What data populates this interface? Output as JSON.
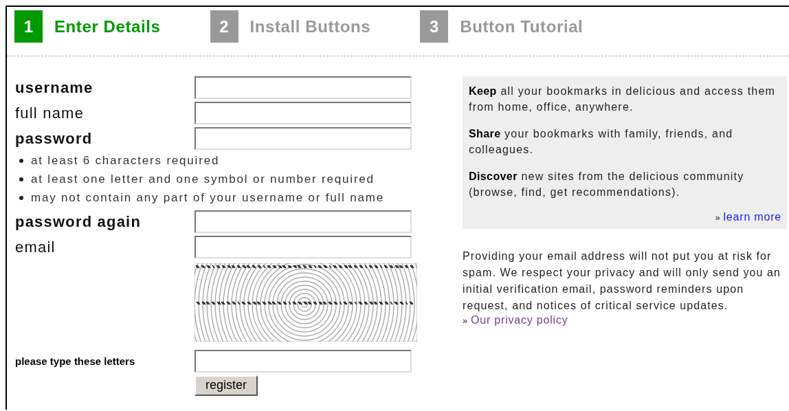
{
  "steps": [
    {
      "number": "1",
      "label": "Enter Details",
      "selected": true
    },
    {
      "number": "2",
      "label": "Install Buttons",
      "selected": false
    },
    {
      "number": "3",
      "label": "Button Tutorial",
      "selected": false
    }
  ],
  "form": {
    "fields": [
      {
        "label": "username",
        "required": true
      },
      {
        "label": "full name",
        "required": false
      },
      {
        "label": "password",
        "required": true,
        "rules": [
          "at least 6 characters required",
          "at least one letter and one symbol or number required",
          "may not contain any part of your username or full name"
        ]
      },
      {
        "label": "password again",
        "required": true
      },
      {
        "label": "email",
        "required": false
      }
    ],
    "captcha": {
      "label": "please type these letters"
    },
    "submit": "register"
  },
  "info_panel": {
    "paragraphs": [
      "**Keep** all your bookmarks in delicious and access them from home, office, anywhere.",
      "**Share** your bookmarks with family, friends, and colleagues.",
      "**Discover** new sites from the delicious community (browse, find, get recommendations)."
    ],
    "link_marker": "»",
    "link": "learn more"
  },
  "privacy": {
    "text": "Providing your email address will not put you at risk for spam. We respect your privacy and will only send you an initial verification email, password reminders upon request, and notices of critical service updates.",
    "link_marker": "»",
    "link": "Our privacy policy"
  }
}
